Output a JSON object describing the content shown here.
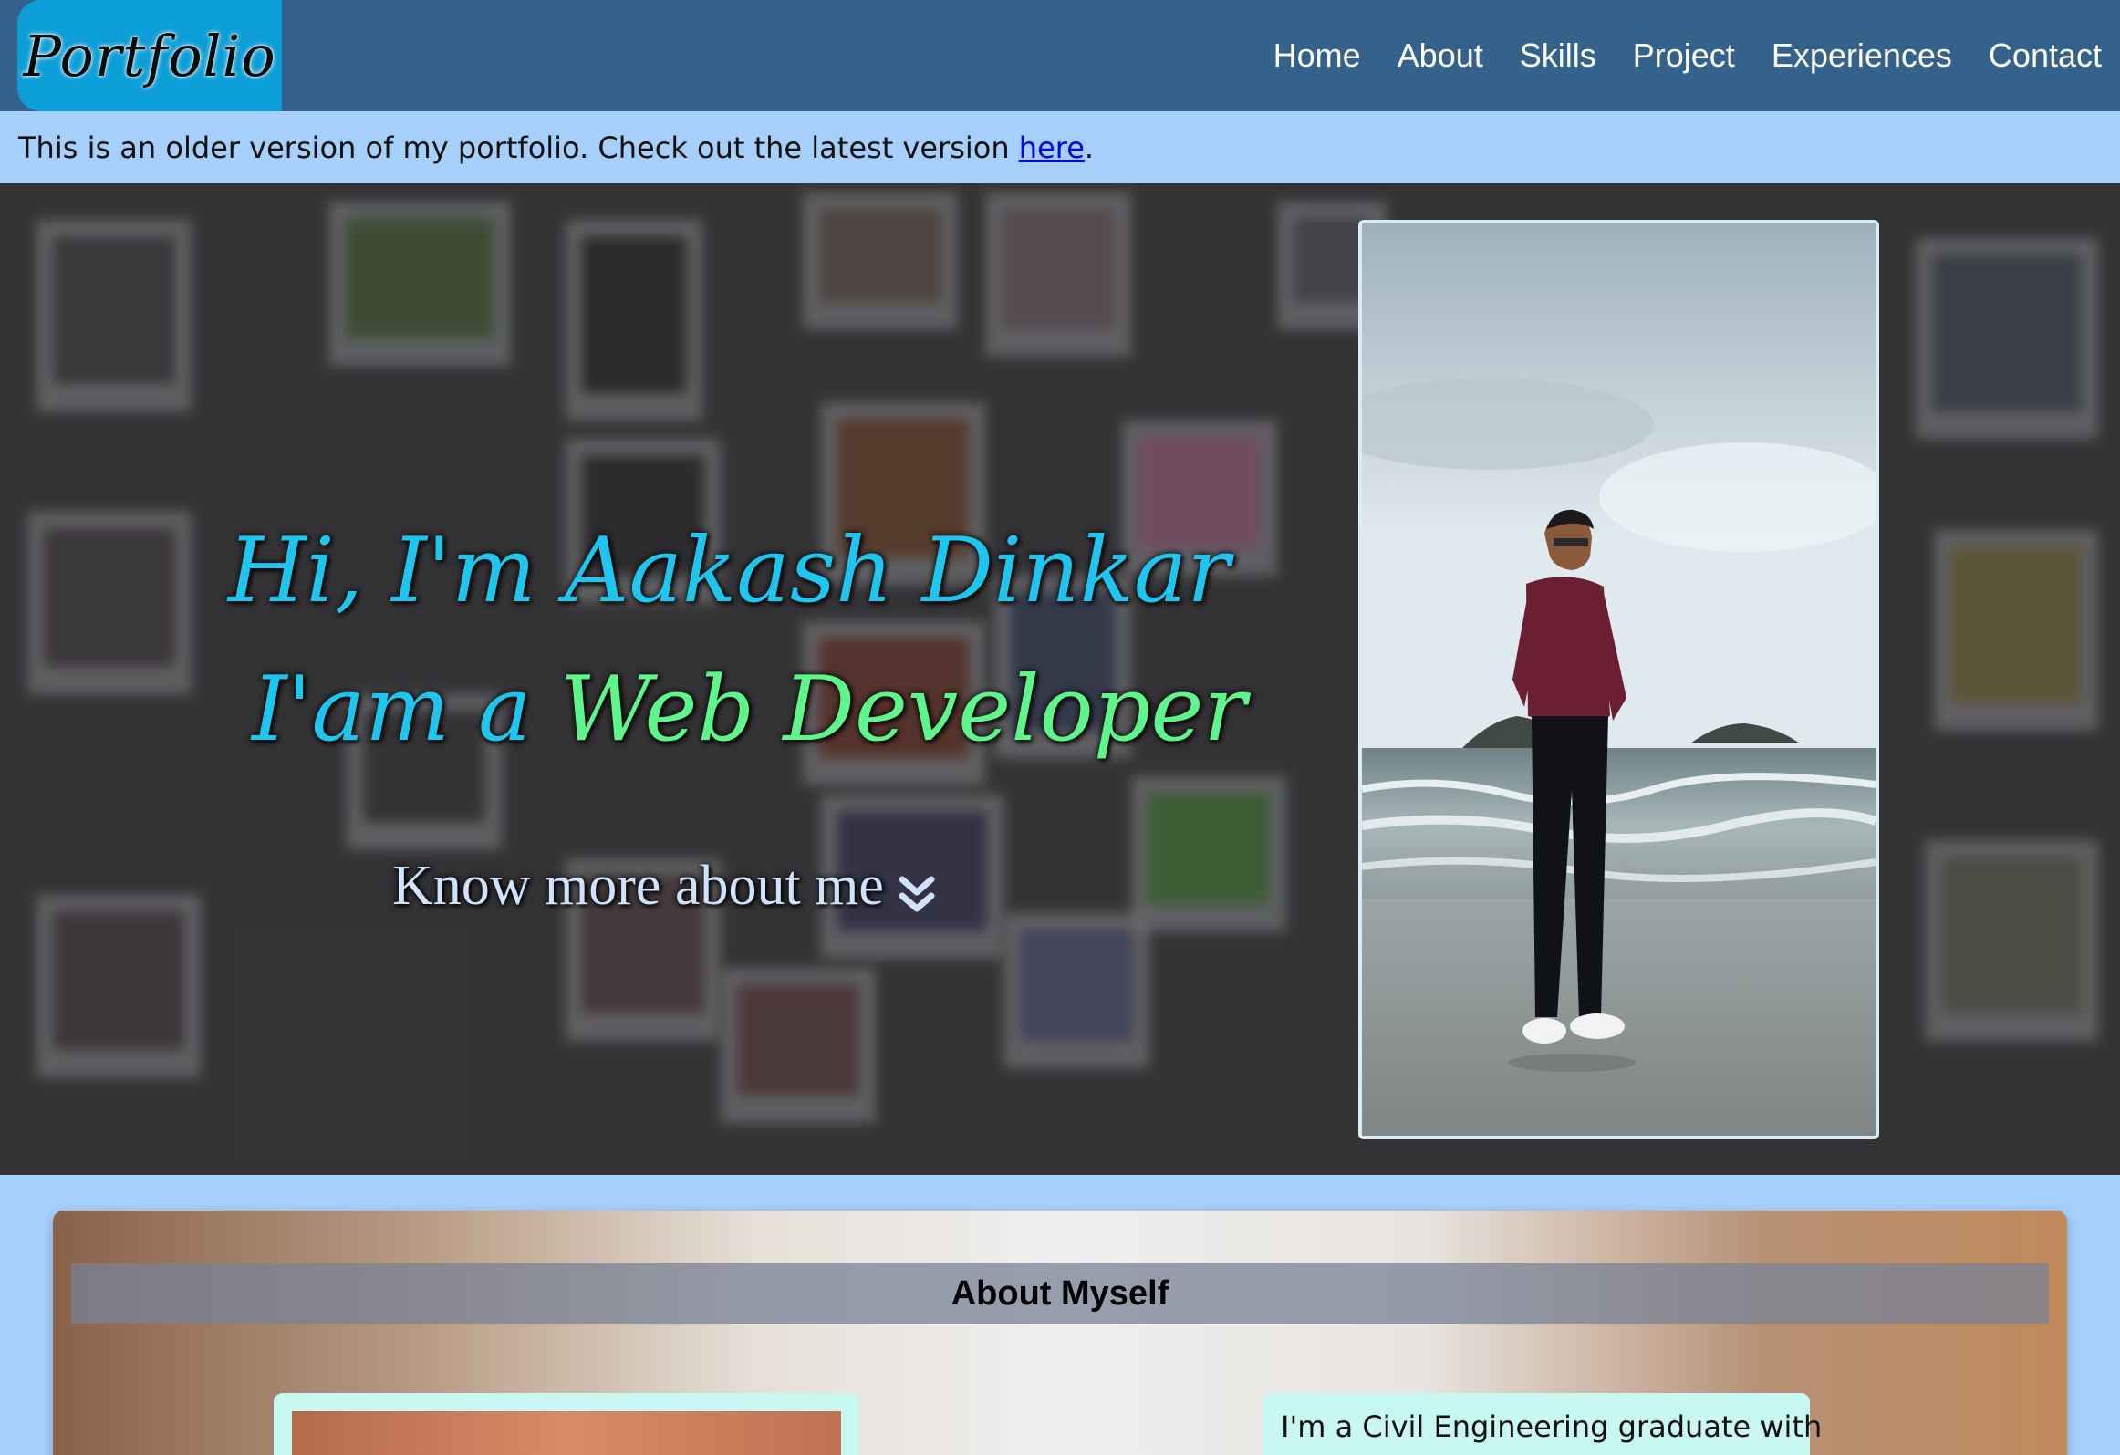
{
  "navbar": {
    "logo": "Portfolio",
    "links": [
      "Home",
      "About",
      "Skills",
      "Project",
      "Experiences",
      "Contact"
    ]
  },
  "notice": {
    "text_before": "This is an older version of my portfolio. Check out the latest version ",
    "link_text": "here",
    "text_after": "."
  },
  "hero": {
    "greeting": "Hi, I'm Aakash Dinkar",
    "role_prefix": "I'am a ",
    "role": "Web Developer",
    "cta": "Know more about me",
    "cta_icon": "double-chevron-down-icon"
  },
  "about": {
    "title": "About Myself",
    "intro": "I'm a Civil Engineering graduate with"
  },
  "colors": {
    "navbar": "#35628a",
    "logo_bg": "#0c9ed6",
    "notice_bg": "#a6d0fb",
    "hero_cyan": "#1ec6ef",
    "hero_green": "#5ef58a",
    "card_bg": "#c9f7f2"
  }
}
